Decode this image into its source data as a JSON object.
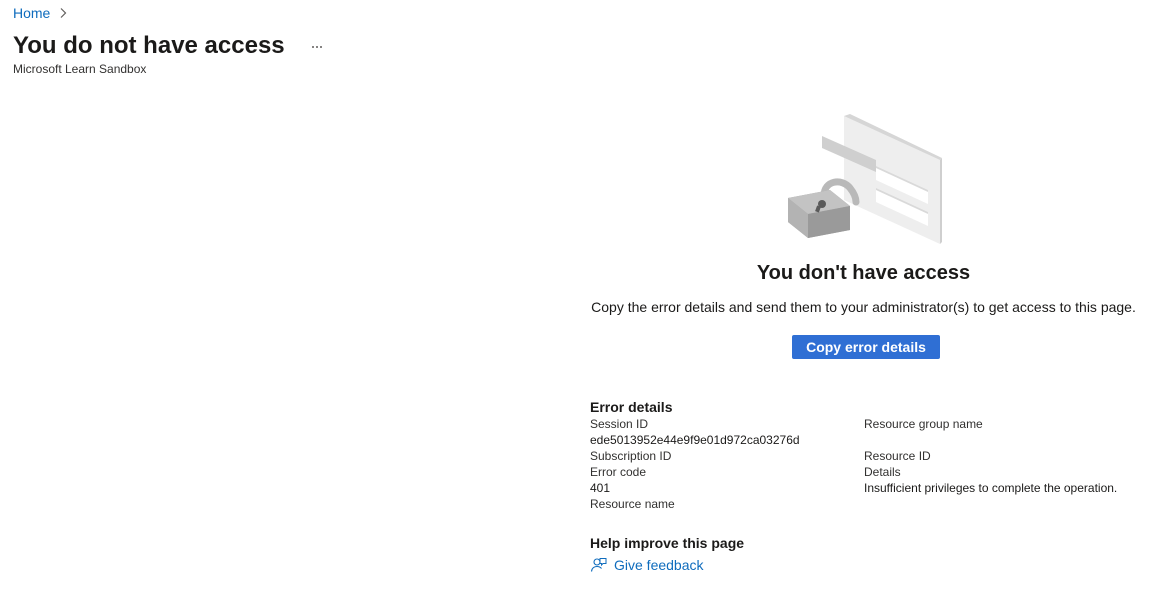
{
  "breadcrumb": {
    "home_label": "Home"
  },
  "header": {
    "title": "You do not have access",
    "subtitle": "Microsoft Learn Sandbox",
    "more_icon": "ellipsis-icon"
  },
  "message": {
    "heading": "You don't have access",
    "description": "Copy the error details and send them to your administrator(s) to get access to this page.",
    "copy_button_label": "Copy error details"
  },
  "error_details": {
    "title": "Error details",
    "left": {
      "session_id_label": "Session ID",
      "session_id_value": "ede5013952e44e9f9e01d972ca03276d",
      "subscription_id_label": "Subscription ID",
      "error_code_label": "Error code",
      "error_code_value": "401",
      "resource_name_label": "Resource name"
    },
    "right": {
      "resource_group_label": "Resource group name",
      "resource_id_label": "Resource ID",
      "details_label": "Details",
      "details_value": "Insufficient privileges to complete the operation."
    }
  },
  "help": {
    "title": "Help improve this page",
    "feedback_label": "Give feedback",
    "feedback_icon": "feedback-icon"
  },
  "colors": {
    "link": "#0f6cbd",
    "primary_button": "#2f6fd4",
    "text": "#323130"
  }
}
